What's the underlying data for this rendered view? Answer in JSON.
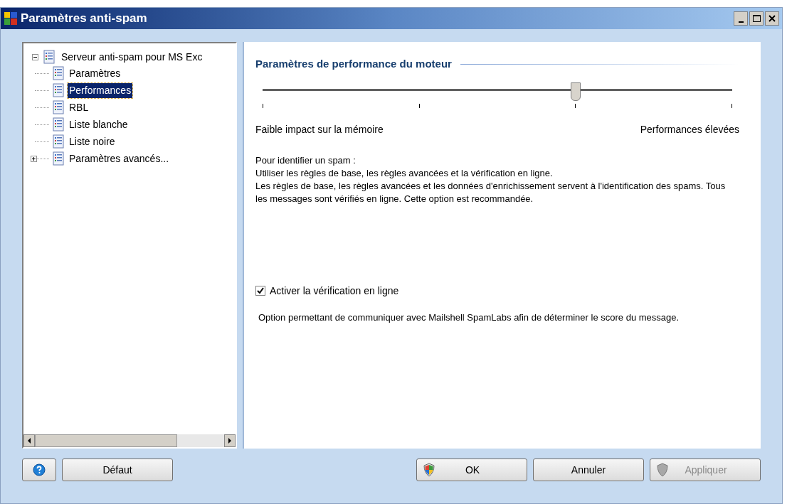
{
  "window": {
    "title": "Paramètres anti-spam"
  },
  "tree": {
    "label": "Serveur anti-spam pour MS Exc",
    "expanded": true,
    "selected": false,
    "children": [
      {
        "label": "Paramètres",
        "selected": false
      },
      {
        "label": "Performances",
        "selected": true
      },
      {
        "label": "RBL",
        "selected": false
      },
      {
        "label": "Liste blanche",
        "selected": false
      },
      {
        "label": "Liste noire",
        "selected": false
      },
      {
        "label": "Paramètres avancés...",
        "selected": false,
        "expanded": false
      }
    ]
  },
  "section": {
    "title": "Paramètres de performance du moteur",
    "slider": {
      "level": 0.667,
      "min_label": "Faible impact sur la mémoire",
      "max_label": "Performances élevées"
    },
    "description": [
      "Pour identifier un spam :",
      "Utiliser les règles de base, les règles avancées et la vérification en ligne.",
      "Les règles de base, les règles avancées et les données d'enrichissement servent à l'identification des spams. Tous les messages sont vérifiés en ligne. Cette option est recommandée."
    ],
    "checkbox": {
      "label": "Activer la vérification en ligne",
      "checked": true
    },
    "note": "Option permettant de communiquer avec Mailshell SpamLabs afin de déterminer le score du message."
  },
  "buttons": [
    {
      "kind": "help"
    },
    {
      "kind": "plain",
      "label": "Défaut"
    },
    {
      "kind": "shield",
      "label": "OK",
      "disabled": false
    },
    {
      "kind": "plain",
      "label": "Annuler"
    },
    {
      "kind": "shield",
      "label": "Appliquer",
      "disabled": true
    }
  ]
}
